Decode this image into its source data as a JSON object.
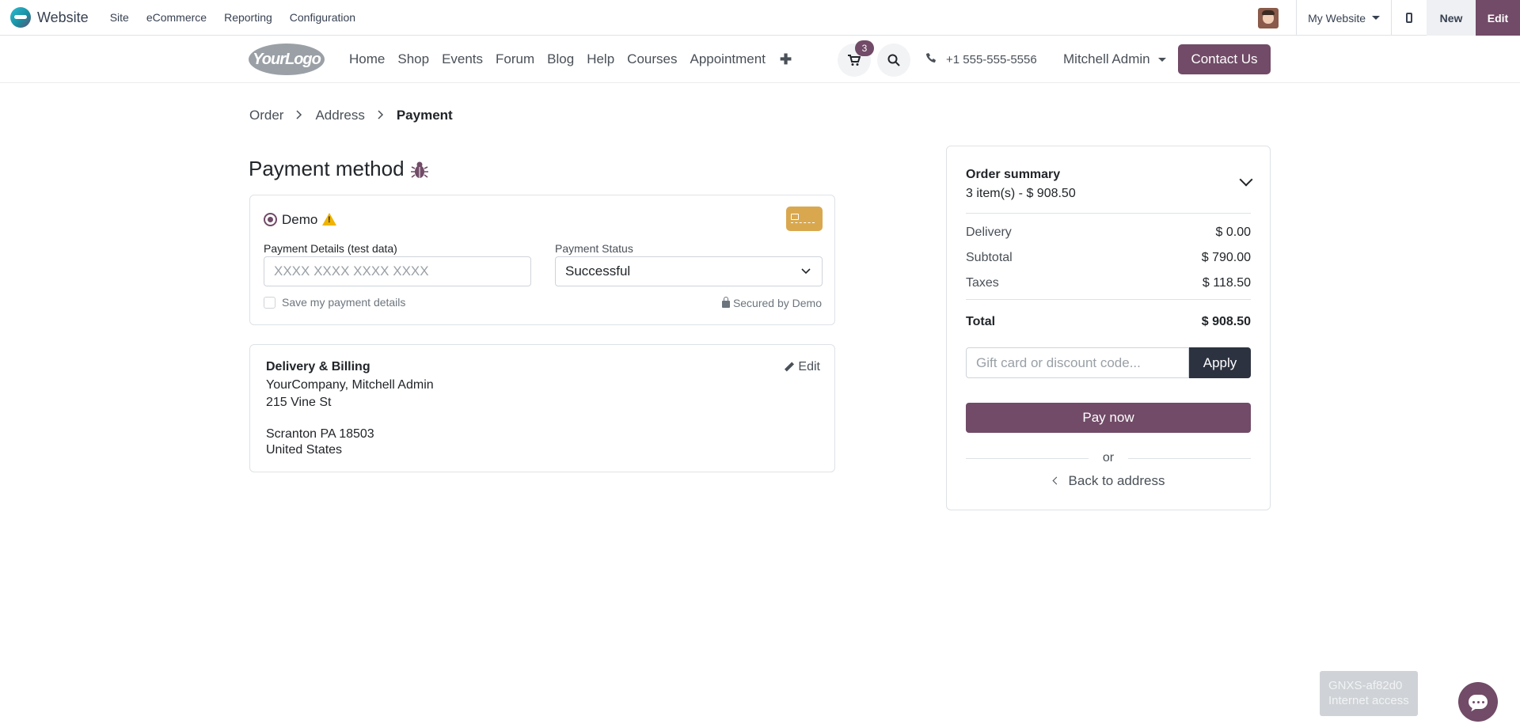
{
  "adminbar": {
    "app_name": "Website",
    "menu": [
      "Site",
      "eCommerce",
      "Reporting",
      "Configuration"
    ],
    "website_switcher": "My Website",
    "new_label": "New",
    "edit_label": "Edit"
  },
  "header": {
    "logo_text": "YourLogo",
    "nav": [
      "Home",
      "Shop",
      "Events",
      "Forum",
      "Blog",
      "Help",
      "Courses",
      "Appointment"
    ],
    "plus": "✚",
    "cart_count": "3",
    "phone": "+1 555-555-5556",
    "user": "Mitchell Admin",
    "contact_label": "Contact Us"
  },
  "breadcrumb": {
    "items": [
      "Order",
      "Address",
      "Payment"
    ]
  },
  "payment": {
    "title": "Payment method",
    "provider": "Demo",
    "details_label": "Payment Details (test data)",
    "details_placeholder": "XXXX XXXX XXXX XXXX",
    "status_label": "Payment Status",
    "status_value": "Successful",
    "save_label": "Save my payment details",
    "secured_by": "Secured by Demo"
  },
  "delivery": {
    "title": "Delivery & Billing",
    "edit_label": "Edit",
    "line1": "YourCompany, Mitchell Admin",
    "line2": "215 Vine St",
    "line3": "Scranton PA 18503",
    "line4": "United States"
  },
  "summary": {
    "title": "Order summary",
    "items_text": "3 item(s) -  $ 908.50",
    "rows": [
      {
        "label": "Delivery",
        "value": "$ 0.00"
      },
      {
        "label": "Subtotal",
        "value": "$ 790.00"
      },
      {
        "label": "Taxes",
        "value": "$ 118.50"
      }
    ],
    "total_label": "Total",
    "total_value": "$ 908.50",
    "gift_placeholder": "Gift card or discount code...",
    "apply_label": "Apply",
    "pay_label": "Pay now",
    "or_label": "or",
    "back_label": "Back to address"
  },
  "toast": {
    "line1": "GNXS-af82d0",
    "line2": "Internet access"
  },
  "colors": {
    "brand": "#714b67",
    "dark_button": "#2c3240",
    "warning": "#f0b400"
  }
}
